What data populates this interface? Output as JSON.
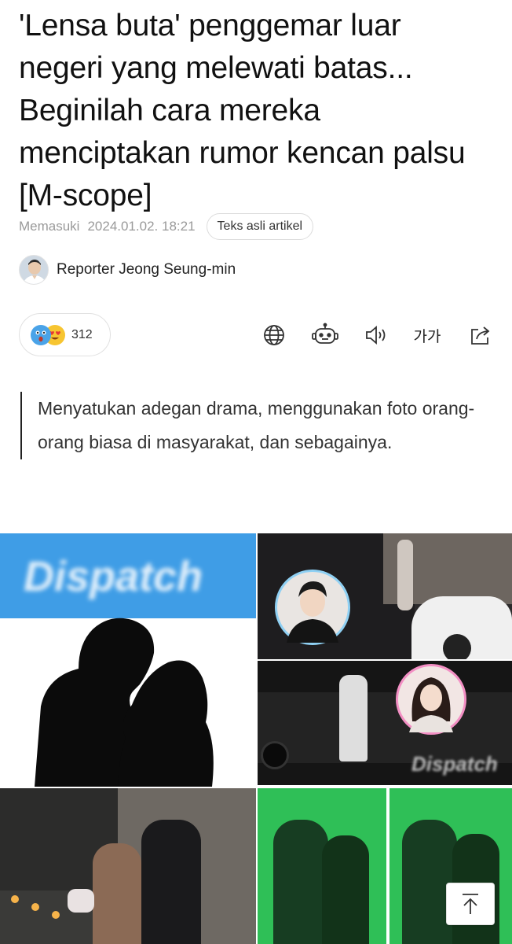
{
  "article": {
    "title": "'Lensa buta' penggemar luar negeri yang melewati batas... Beginilah cara mereka menciptakan rumor kencan palsu [M-scope]",
    "entered_label": "Memasuki",
    "entered_date": "2024.01.02. 18:21",
    "original_text_button": "Teks asli artikel",
    "reporter": "Reporter Jeong Seung-min",
    "summary": "Menyatukan adegan drama, menggunakan foto orang-orang biasa di masyarakat, dan sebagainya."
  },
  "reactions": {
    "count": "312",
    "icons": [
      "surprised-emoji-icon",
      "heart-eyes-emoji-icon"
    ]
  },
  "toolbar": {
    "icons": [
      "globe-icon",
      "robot-icon",
      "speaker-icon",
      "font-size-icon",
      "share-icon"
    ],
    "font_size_label": "가가"
  },
  "photo": {
    "watermark_top": "Dispatch",
    "watermark_bottom": "Dispatch"
  },
  "colors": {
    "dispatch_blue": "#3f9de6",
    "screen_green": "#2fbf57",
    "text_gray": "#9a9a9a"
  }
}
